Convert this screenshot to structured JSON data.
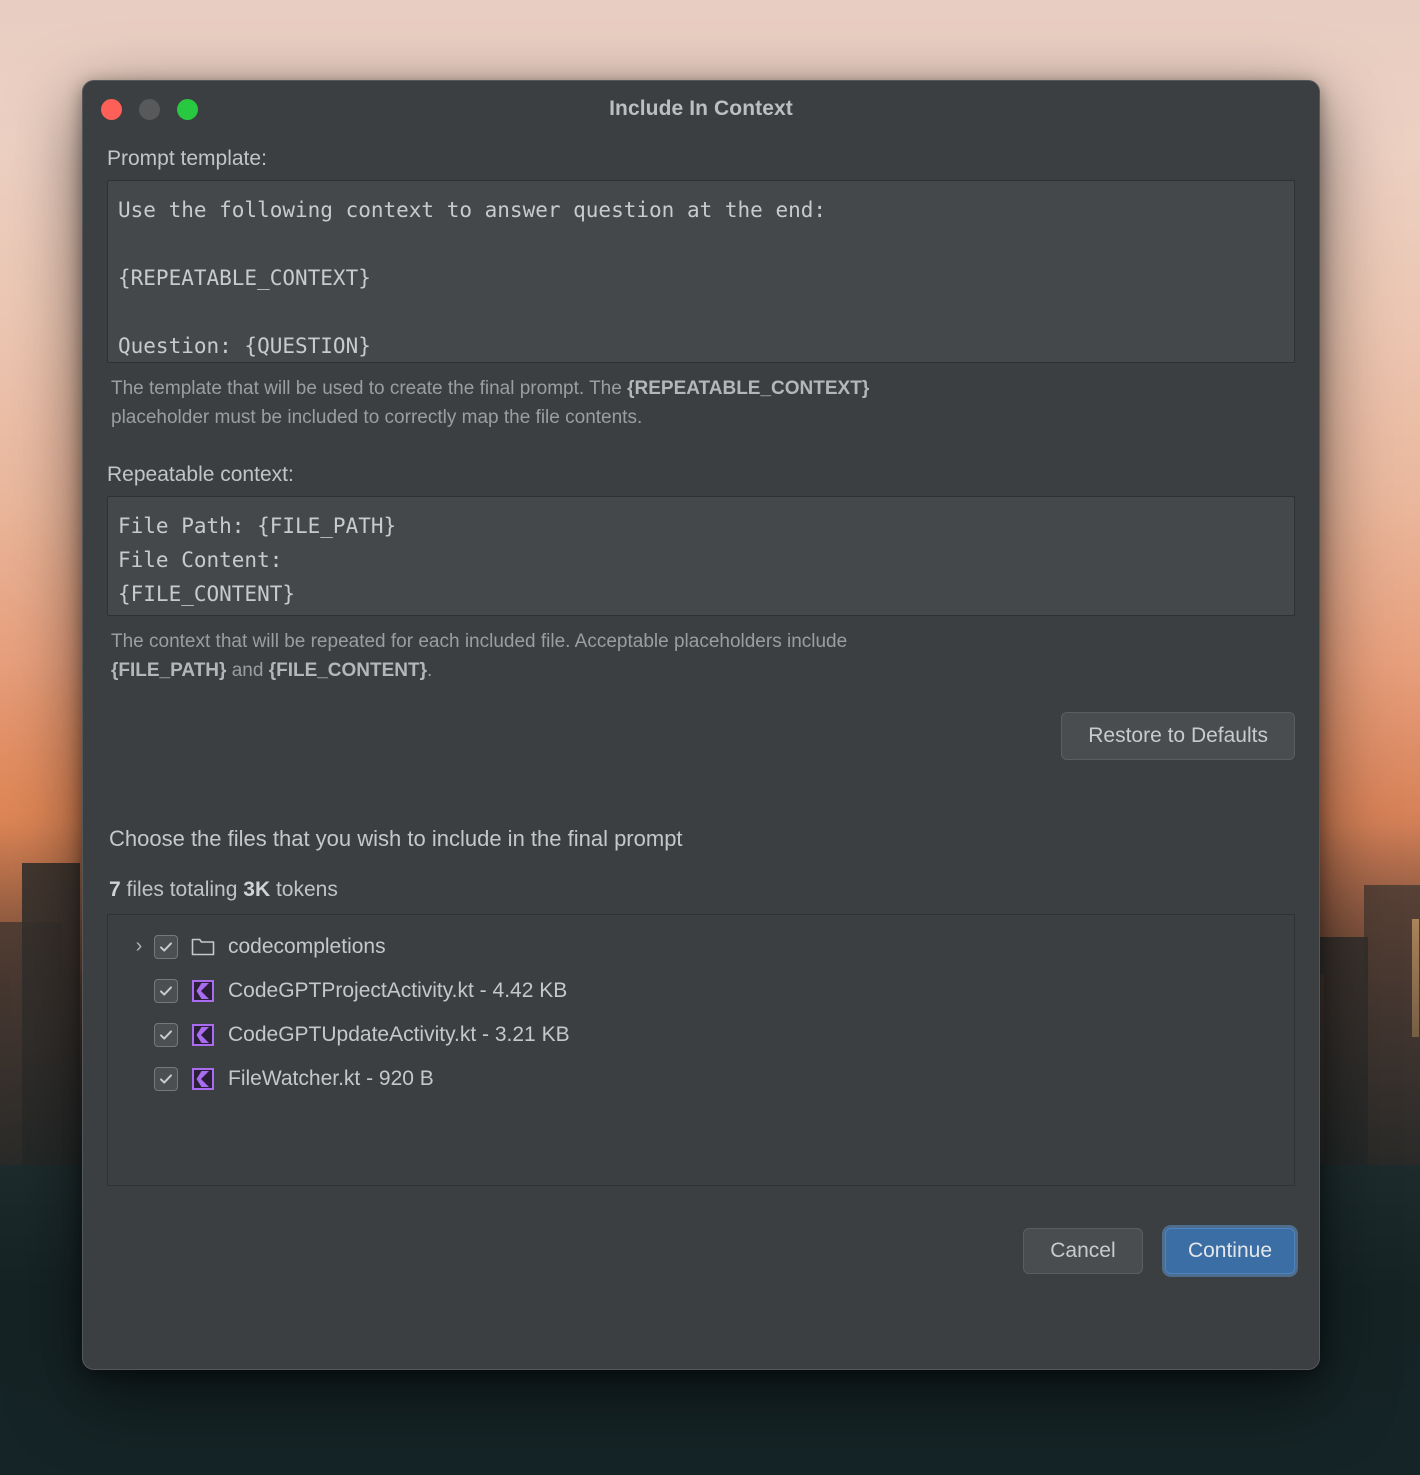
{
  "window": {
    "title": "Include In Context",
    "traffic_lights": [
      "close-button",
      "minimize-button",
      "maximize-button"
    ]
  },
  "prompt_template": {
    "label": "Prompt template:",
    "value": "Use the following context to answer question at the end:\n\n{REPEATABLE_CONTEXT}\n\nQuestion: {QUESTION}",
    "help_prefix": "The template that will be used to create the final prompt. The ",
    "help_bold": "{REPEATABLE_CONTEXT}",
    "help_suffix": " placeholder must be included to correctly map the file contents."
  },
  "repeatable_context": {
    "label": "Repeatable context:",
    "value": "File Path: {FILE_PATH}\nFile Content:\n{FILE_CONTENT}",
    "help_prefix": "The context that will be repeated for each included file. Acceptable placeholders include ",
    "help_bold_1": "{FILE_PATH}",
    "help_mid": " and ",
    "help_bold_2": "{FILE_CONTENT}",
    "help_suffix": "."
  },
  "restore": {
    "label": "Restore to Defaults"
  },
  "files_section": {
    "heading": "Choose the files that you wish to include in the final prompt",
    "summary_count": "7",
    "summary_mid": " files totaling ",
    "summary_tokens": "3K",
    "summary_suffix": " tokens",
    "rows": [
      {
        "name": "codecompletions",
        "icon": "folder-icon",
        "checked": true,
        "expandable": true,
        "expander": "›",
        "indent": false
      },
      {
        "name": "CodeGPTProjectActivity.kt - 4.42 KB",
        "icon": "kotlin-file-icon",
        "checked": true,
        "expandable": false,
        "expander": "",
        "indent": true
      },
      {
        "name": "CodeGPTUpdateActivity.kt - 3.21 KB",
        "icon": "kotlin-file-icon",
        "checked": true,
        "expandable": false,
        "expander": "",
        "indent": true
      },
      {
        "name": "FileWatcher.kt - 920 B",
        "icon": "kotlin-file-icon",
        "checked": true,
        "expandable": false,
        "expander": "",
        "indent": true
      }
    ]
  },
  "footer": {
    "cancel_label": "Cancel",
    "continue_label": "Continue"
  },
  "colors": {
    "dialog_background": "#3c3f41",
    "input_background": "#45484a",
    "accent_blue": "#3b6ea5",
    "focus_ring": "#5c96d2",
    "kotlin_purple": "#a96bf0",
    "traffic_red": "#fe5f57",
    "traffic_yellow": "#58595b",
    "traffic_green": "#28c840",
    "text_primary": "#c5c8ca",
    "text_muted": "#9b9ea0"
  }
}
